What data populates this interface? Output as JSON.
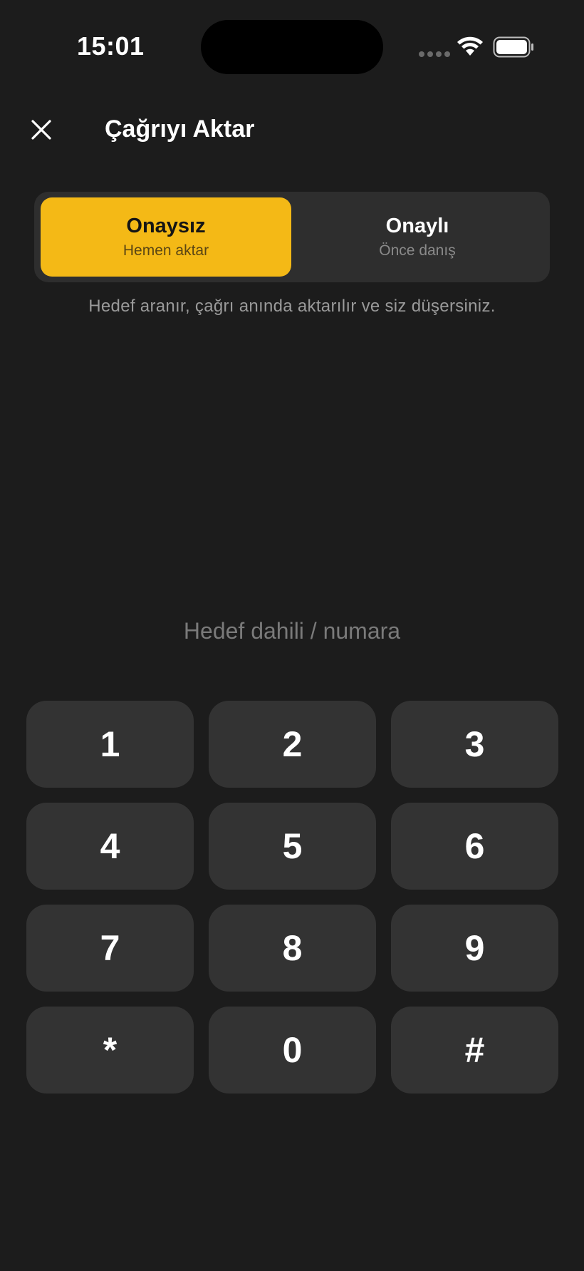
{
  "status_bar": {
    "time": "15:01",
    "icons": [
      "cellular-signal-icon",
      "wifi-icon",
      "battery-icon"
    ]
  },
  "header": {
    "close_icon": "close-icon",
    "title": "Çağrıyı Aktar"
  },
  "transfer_mode": {
    "selected": "blind",
    "options": [
      {
        "id": "blind",
        "title": "Onaysız",
        "subtitle": "Hemen aktar"
      },
      {
        "id": "attended",
        "title": "Onaylı",
        "subtitle": "Önce danış"
      }
    ],
    "description": "Hedef aranır, çağrı anında aktarılır ve siz düşersiniz."
  },
  "target": {
    "value": "",
    "placeholder": "Hedef dahili / numara"
  },
  "keypad": {
    "keys": [
      "1",
      "2",
      "3",
      "4",
      "5",
      "6",
      "7",
      "8",
      "9",
      "*",
      "0",
      "#"
    ]
  },
  "colors": {
    "background": "#1c1c1c",
    "accent": "#f4b916",
    "key_background": "#333333",
    "segment_background": "#2e2e2e"
  }
}
